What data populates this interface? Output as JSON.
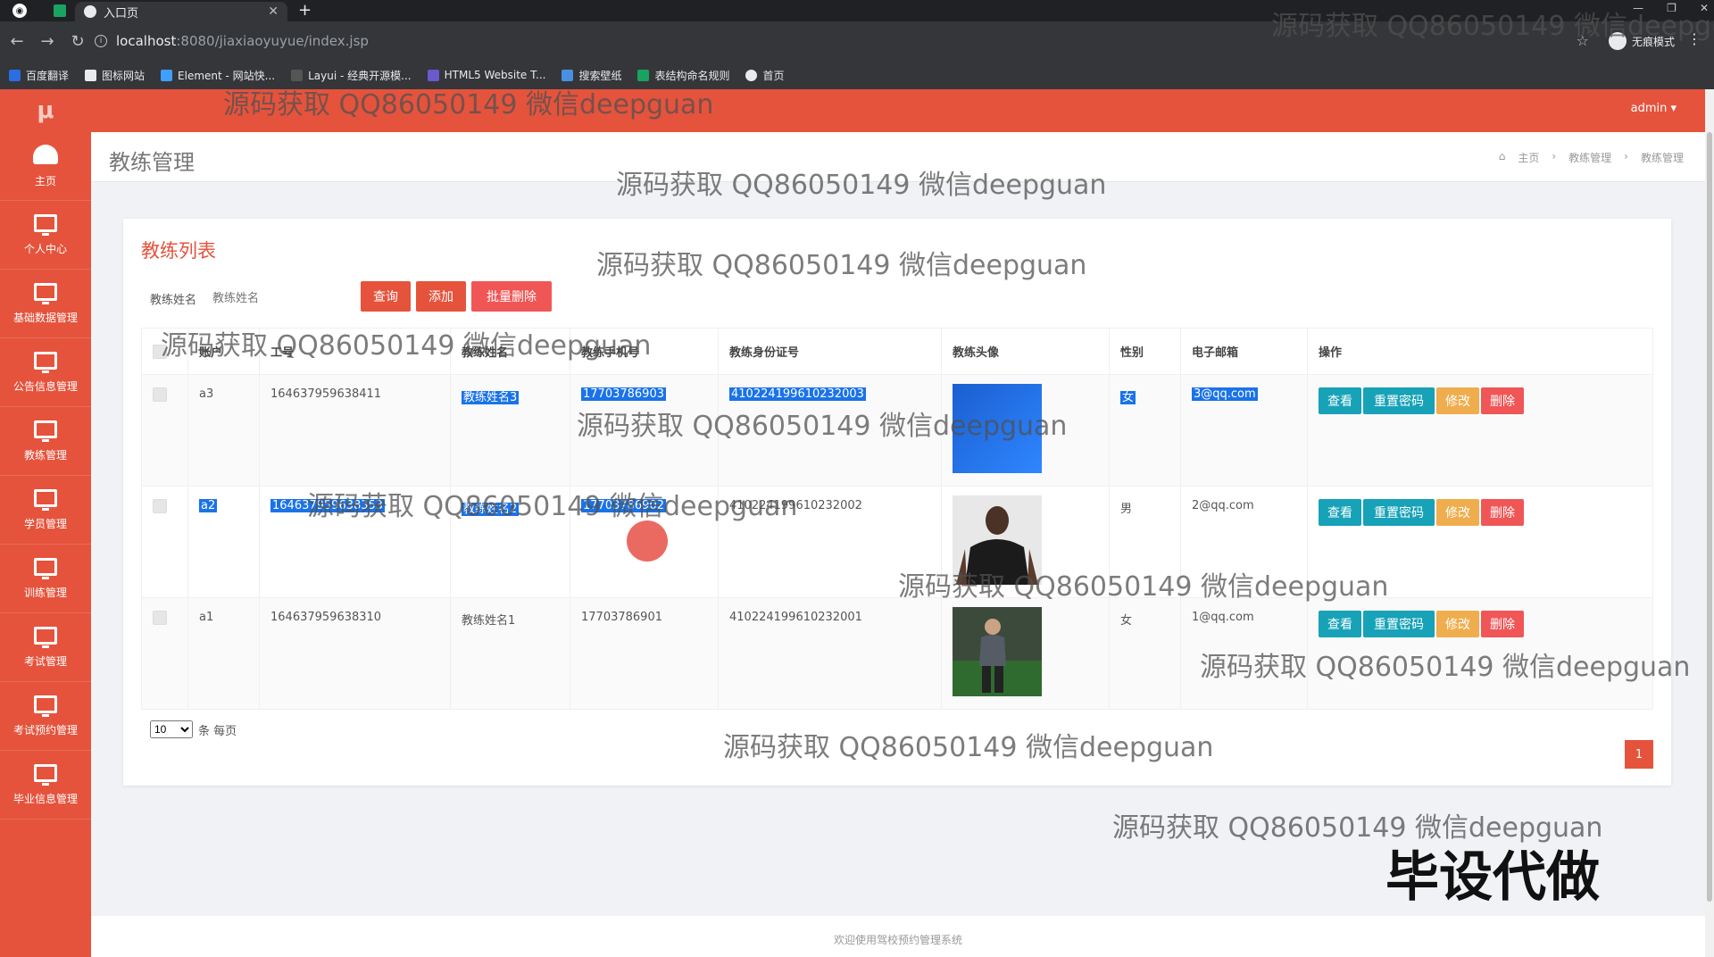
{
  "browser": {
    "tab_title": "入口页",
    "url_host": "localhost",
    "url_path": ":8080/jiaxiaoyuyue/index.jsp",
    "incognito_label": "无痕模式",
    "bookmarks": [
      "百度翻译",
      "图标网站",
      "Element - 网站快...",
      "Layui - 经典开源模...",
      "HTML5 Website T...",
      "搜索壁纸",
      "表结构命名规则",
      "首页"
    ]
  },
  "header": {
    "admin": "admin ▾"
  },
  "sidebar": {
    "logo": "μ",
    "items": [
      "主页",
      "个人中心",
      "基础数据管理",
      "公告信息管理",
      "教练管理",
      "学员管理",
      "训练管理",
      "考试管理",
      "考试预约管理",
      "毕业信息管理"
    ]
  },
  "page": {
    "title": "教练管理",
    "breadcrumb": [
      "主页",
      "教练管理",
      "教练管理"
    ]
  },
  "list": {
    "title": "教练列表",
    "search_label": "教练姓名",
    "search_placeholder": "教练姓名",
    "btn_query": "查询",
    "btn_add": "添加",
    "btn_batch_delete": "批量删除",
    "columns": [
      "账户",
      "工号",
      "教练姓名",
      "教练手机号",
      "教练身份证号",
      "教练头像",
      "性别",
      "电子邮箱",
      "操作"
    ],
    "rows": [
      {
        "account": "a3",
        "job_no": "164637959638411",
        "name": "教练姓名3",
        "phone": "17703786903",
        "id_card": "410224199610232003",
        "gender": "女",
        "email": "3@qq.com"
      },
      {
        "account": "a2",
        "job_no": "164637959638353",
        "name": "教练姓名2",
        "phone": "17703786902",
        "id_card": "410224199610232002",
        "gender": "男",
        "email": "2@qq.com"
      },
      {
        "account": "a1",
        "job_no": "164637959638310",
        "name": "教练姓名1",
        "phone": "17703786901",
        "id_card": "410224199610232001",
        "gender": "女",
        "email": "1@qq.com"
      }
    ],
    "actions": {
      "view": "查看",
      "reset": "重置密码",
      "edit": "修改",
      "delete": "删除"
    },
    "page_size": "10",
    "page_size_suffix": "条 每页",
    "current_page": "1"
  },
  "footer": "欢迎使用驾校预约管理系统",
  "watermark": "源码获取 QQ86050149 微信deepguan",
  "stamp": "毕设代做",
  "colors": {
    "primary": "#e5533c",
    "info": "#17a2b8",
    "warning": "#f0ad4e",
    "danger": "#f05656"
  }
}
